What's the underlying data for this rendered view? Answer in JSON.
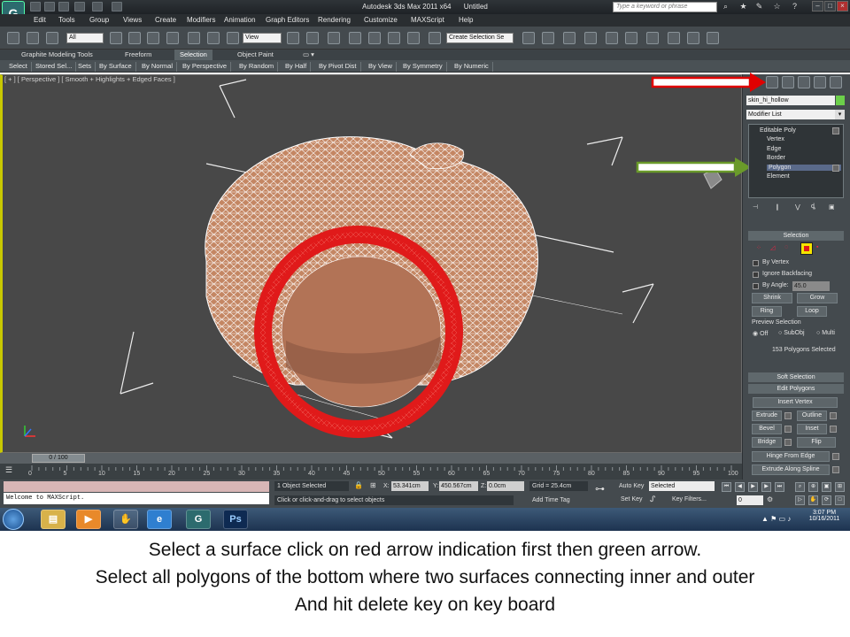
{
  "window": {
    "app_title": "Autodesk 3ds Max  2011 x64",
    "doc_title": "Untitled",
    "search_placeholder": "Type a keyword or phrase"
  },
  "menu": [
    "Edit",
    "Tools",
    "Group",
    "Views",
    "Create",
    "Modifiers",
    "Animation",
    "Graph Editors",
    "Rendering",
    "Customize",
    "MAXScript",
    "Help"
  ],
  "toolbar": {
    "filter_value": "All",
    "refcoord_value": "View",
    "selection_set_placeholder": "Create Selection Se"
  },
  "ribbon": {
    "tabs": [
      "Graphite Modeling Tools",
      "Freeform",
      "Selection",
      "Object Paint"
    ],
    "active_tab": "Selection",
    "buttons": [
      "Select",
      "Stored Sel...",
      "Sets",
      "By Surface",
      "By Normal",
      "By Perspective",
      "By Random",
      "By Half",
      "By Pivot Dist",
      "By View",
      "By Symmetry",
      "By Numeric"
    ]
  },
  "viewport": {
    "label": "[ + ] [ Perspective ] [ Smooth + Highlights + Edged Faces ]"
  },
  "command_panel": {
    "object_name": "skin_hi_hollow",
    "modifier_list": "Modifier List",
    "stack": [
      "Editable Poly",
      "Vertex",
      "Edge",
      "Border",
      "Polygon",
      "Element"
    ],
    "selection_header": "Selection",
    "by_vertex": "By Vertex",
    "ignore_backfacing": "Ignore Backfacing",
    "by_angle": "By Angle:",
    "angle_value": "45.0",
    "shrink": "Shrink",
    "grow": "Grow",
    "ring": "Ring",
    "loop": "Loop",
    "preview_selection": "Preview Selection",
    "preview_options": [
      "Off",
      "SubObj",
      "Multi"
    ],
    "selected_count": "153 Polygons Selected",
    "soft_selection": "Soft Selection",
    "edit_polygons": "Edit Polygons",
    "insert_vertex": "Insert Vertex",
    "extrude": "Extrude",
    "outline": "Outline",
    "bevel": "Bevel",
    "inset": "Inset",
    "bridge": "Bridge",
    "flip": "Flip",
    "hinge_from_edge": "Hinge From Edge",
    "extrude_along_spline": "Extrude Along Spline"
  },
  "timeline": {
    "frame_display": "0 / 100",
    "ticks": [
      "0",
      "5",
      "10",
      "15",
      "20",
      "25",
      "30",
      "35",
      "40",
      "45",
      "50",
      "55",
      "60",
      "65",
      "70",
      "75",
      "80",
      "85",
      "90",
      "95",
      "100"
    ]
  },
  "status": {
    "maxscript_text": "Welcome to MAXScript.",
    "object_selected": "1 Object Selected",
    "prompt": "Click or click-and-drag to select objects",
    "x_label": "X:",
    "x_value": "53.341cm",
    "y_label": "Y:",
    "y_value": "450.567cm",
    "z_label": "Z:",
    "z_value": "0.0cm",
    "grid": "Grid = 25.4cm",
    "add_time_tag": "Add Time Tag",
    "auto_key": "Auto Key",
    "selected_dd": "Selected",
    "set_key": "Set Key",
    "key_filters": "Key Filters...",
    "frame_value": "0"
  },
  "taskbar": {
    "time": "3:07 PM",
    "date": "10/16/2011",
    "ps_label": "Ps"
  },
  "caption": {
    "line1": "Select a surface click on red arrow indication first then green arrow.",
    "line2": "Select all polygons of the bottom where two surfaces connecting inner and outer",
    "line3": "And hit delete key  on key board"
  },
  "colors": {
    "red_arrow": "#e00000",
    "green_arrow": "#6a9a2a",
    "selection_red": "#e01a1a",
    "mesh_tan": "#c98a66"
  }
}
